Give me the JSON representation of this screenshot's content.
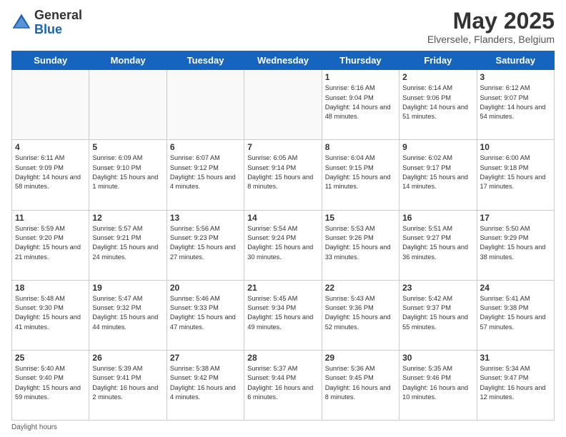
{
  "header": {
    "logo_general": "General",
    "logo_blue": "Blue",
    "month_title": "May 2025",
    "location": "Elversele, Flanders, Belgium"
  },
  "days_of_week": [
    "Sunday",
    "Monday",
    "Tuesday",
    "Wednesday",
    "Thursday",
    "Friday",
    "Saturday"
  ],
  "weeks": [
    [
      {
        "day": "",
        "info": ""
      },
      {
        "day": "",
        "info": ""
      },
      {
        "day": "",
        "info": ""
      },
      {
        "day": "",
        "info": ""
      },
      {
        "day": "1",
        "info": "Sunrise: 6:16 AM\nSunset: 9:04 PM\nDaylight: 14 hours\nand 48 minutes."
      },
      {
        "day": "2",
        "info": "Sunrise: 6:14 AM\nSunset: 9:06 PM\nDaylight: 14 hours\nand 51 minutes."
      },
      {
        "day": "3",
        "info": "Sunrise: 6:12 AM\nSunset: 9:07 PM\nDaylight: 14 hours\nand 54 minutes."
      }
    ],
    [
      {
        "day": "4",
        "info": "Sunrise: 6:11 AM\nSunset: 9:09 PM\nDaylight: 14 hours\nand 58 minutes."
      },
      {
        "day": "5",
        "info": "Sunrise: 6:09 AM\nSunset: 9:10 PM\nDaylight: 15 hours\nand 1 minute."
      },
      {
        "day": "6",
        "info": "Sunrise: 6:07 AM\nSunset: 9:12 PM\nDaylight: 15 hours\nand 4 minutes."
      },
      {
        "day": "7",
        "info": "Sunrise: 6:05 AM\nSunset: 9:14 PM\nDaylight: 15 hours\nand 8 minutes."
      },
      {
        "day": "8",
        "info": "Sunrise: 6:04 AM\nSunset: 9:15 PM\nDaylight: 15 hours\nand 11 minutes."
      },
      {
        "day": "9",
        "info": "Sunrise: 6:02 AM\nSunset: 9:17 PM\nDaylight: 15 hours\nand 14 minutes."
      },
      {
        "day": "10",
        "info": "Sunrise: 6:00 AM\nSunset: 9:18 PM\nDaylight: 15 hours\nand 17 minutes."
      }
    ],
    [
      {
        "day": "11",
        "info": "Sunrise: 5:59 AM\nSunset: 9:20 PM\nDaylight: 15 hours\nand 21 minutes."
      },
      {
        "day": "12",
        "info": "Sunrise: 5:57 AM\nSunset: 9:21 PM\nDaylight: 15 hours\nand 24 minutes."
      },
      {
        "day": "13",
        "info": "Sunrise: 5:56 AM\nSunset: 9:23 PM\nDaylight: 15 hours\nand 27 minutes."
      },
      {
        "day": "14",
        "info": "Sunrise: 5:54 AM\nSunset: 9:24 PM\nDaylight: 15 hours\nand 30 minutes."
      },
      {
        "day": "15",
        "info": "Sunrise: 5:53 AM\nSunset: 9:26 PM\nDaylight: 15 hours\nand 33 minutes."
      },
      {
        "day": "16",
        "info": "Sunrise: 5:51 AM\nSunset: 9:27 PM\nDaylight: 15 hours\nand 36 minutes."
      },
      {
        "day": "17",
        "info": "Sunrise: 5:50 AM\nSunset: 9:29 PM\nDaylight: 15 hours\nand 38 minutes."
      }
    ],
    [
      {
        "day": "18",
        "info": "Sunrise: 5:48 AM\nSunset: 9:30 PM\nDaylight: 15 hours\nand 41 minutes."
      },
      {
        "day": "19",
        "info": "Sunrise: 5:47 AM\nSunset: 9:32 PM\nDaylight: 15 hours\nand 44 minutes."
      },
      {
        "day": "20",
        "info": "Sunrise: 5:46 AM\nSunset: 9:33 PM\nDaylight: 15 hours\nand 47 minutes."
      },
      {
        "day": "21",
        "info": "Sunrise: 5:45 AM\nSunset: 9:34 PM\nDaylight: 15 hours\nand 49 minutes."
      },
      {
        "day": "22",
        "info": "Sunrise: 5:43 AM\nSunset: 9:36 PM\nDaylight: 15 hours\nand 52 minutes."
      },
      {
        "day": "23",
        "info": "Sunrise: 5:42 AM\nSunset: 9:37 PM\nDaylight: 15 hours\nand 55 minutes."
      },
      {
        "day": "24",
        "info": "Sunrise: 5:41 AM\nSunset: 9:38 PM\nDaylight: 15 hours\nand 57 minutes."
      }
    ],
    [
      {
        "day": "25",
        "info": "Sunrise: 5:40 AM\nSunset: 9:40 PM\nDaylight: 15 hours\nand 59 minutes."
      },
      {
        "day": "26",
        "info": "Sunrise: 5:39 AM\nSunset: 9:41 PM\nDaylight: 16 hours\nand 2 minutes."
      },
      {
        "day": "27",
        "info": "Sunrise: 5:38 AM\nSunset: 9:42 PM\nDaylight: 16 hours\nand 4 minutes."
      },
      {
        "day": "28",
        "info": "Sunrise: 5:37 AM\nSunset: 9:44 PM\nDaylight: 16 hours\nand 6 minutes."
      },
      {
        "day": "29",
        "info": "Sunrise: 5:36 AM\nSunset: 9:45 PM\nDaylight: 16 hours\nand 8 minutes."
      },
      {
        "day": "30",
        "info": "Sunrise: 5:35 AM\nSunset: 9:46 PM\nDaylight: 16 hours\nand 10 minutes."
      },
      {
        "day": "31",
        "info": "Sunrise: 5:34 AM\nSunset: 9:47 PM\nDaylight: 16 hours\nand 12 minutes."
      }
    ]
  ],
  "footer": {
    "daylight_label": "Daylight hours"
  }
}
